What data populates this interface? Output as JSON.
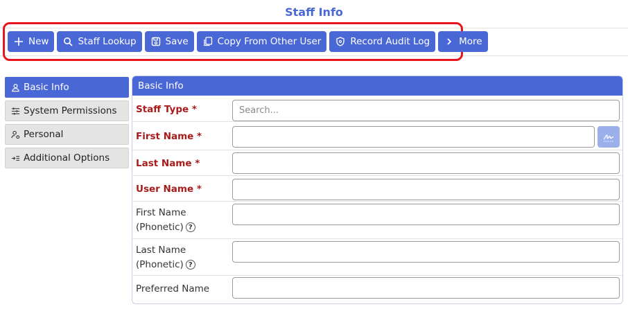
{
  "page": {
    "title": "Staff Info"
  },
  "toolbar": {
    "new_label": "New",
    "staff_lookup_label": "Staff Lookup",
    "save_label": "Save",
    "copy_label": "Copy From Other User",
    "audit_label": "Record Audit Log",
    "more_label": "More"
  },
  "sidebar": {
    "items": [
      {
        "label": "Basic Info",
        "icon": "user-icon",
        "active": true
      },
      {
        "label": "System Permissions",
        "icon": "sliders-icon"
      },
      {
        "label": "Personal",
        "icon": "user-gear-icon"
      },
      {
        "label": "Additional Options",
        "icon": "list-arrow-icon"
      }
    ]
  },
  "panel": {
    "title": "Basic Info",
    "fields": {
      "staff_type": {
        "label": "Staff Type *",
        "placeholder": "Search..."
      },
      "first_name": {
        "label": "First Name *",
        "value": ""
      },
      "last_name": {
        "label": "Last Name *",
        "value": ""
      },
      "user_name": {
        "label": "User Name *",
        "value": ""
      },
      "first_name_phonetic": {
        "line1": "First Name",
        "line2": "(Phonetic)",
        "value": ""
      },
      "last_name_phonetic": {
        "line1": "Last Name",
        "line2": "(Phonetic)",
        "value": ""
      },
      "preferred_name": {
        "label": "Preferred Name",
        "value": ""
      }
    }
  },
  "colors": {
    "accent": "#4a67d6",
    "required": "#a81b1b",
    "highlight": "#e8141c"
  }
}
